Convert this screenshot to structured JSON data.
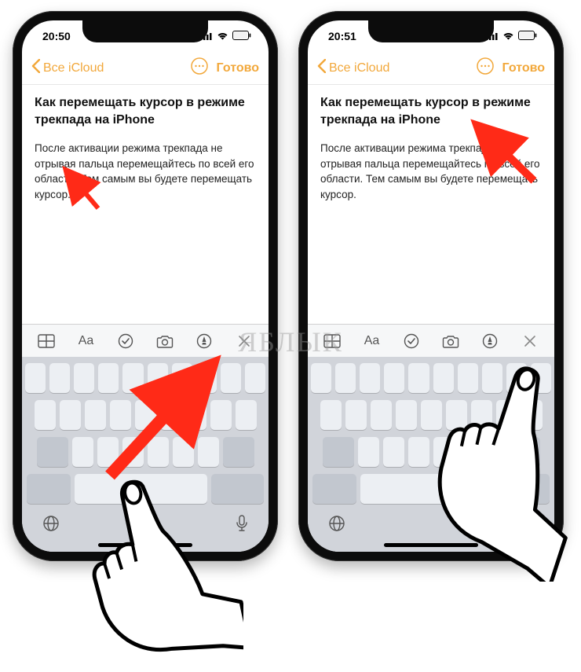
{
  "watermark": "ЯБЛЫК",
  "phones": {
    "left": {
      "time": "20:50",
      "back_label": "Все iCloud",
      "done_label": "Готово",
      "note_title": "Как перемещать курсор в режиме трекпада на iPhone",
      "body_before": "После активации режима трекпада не отрывая пальца перемещайтесь по всей его области. Тем самым вы будете перемещать курсор.",
      "body_after": ""
    },
    "right": {
      "time": "20:51",
      "back_label": "Все iCloud",
      "done_label": "Готово",
      "note_title": "Как перемещать курсор в режиме трекпада на iPhone",
      "body_before": "После активации режима трекпада",
      "body_after": "не отрывая пальца перемещайтесь по всей его области. Тем самым вы будете перемещать курсор."
    }
  },
  "colors": {
    "accent": "#f2a83b",
    "arrow": "#ff2a17"
  }
}
